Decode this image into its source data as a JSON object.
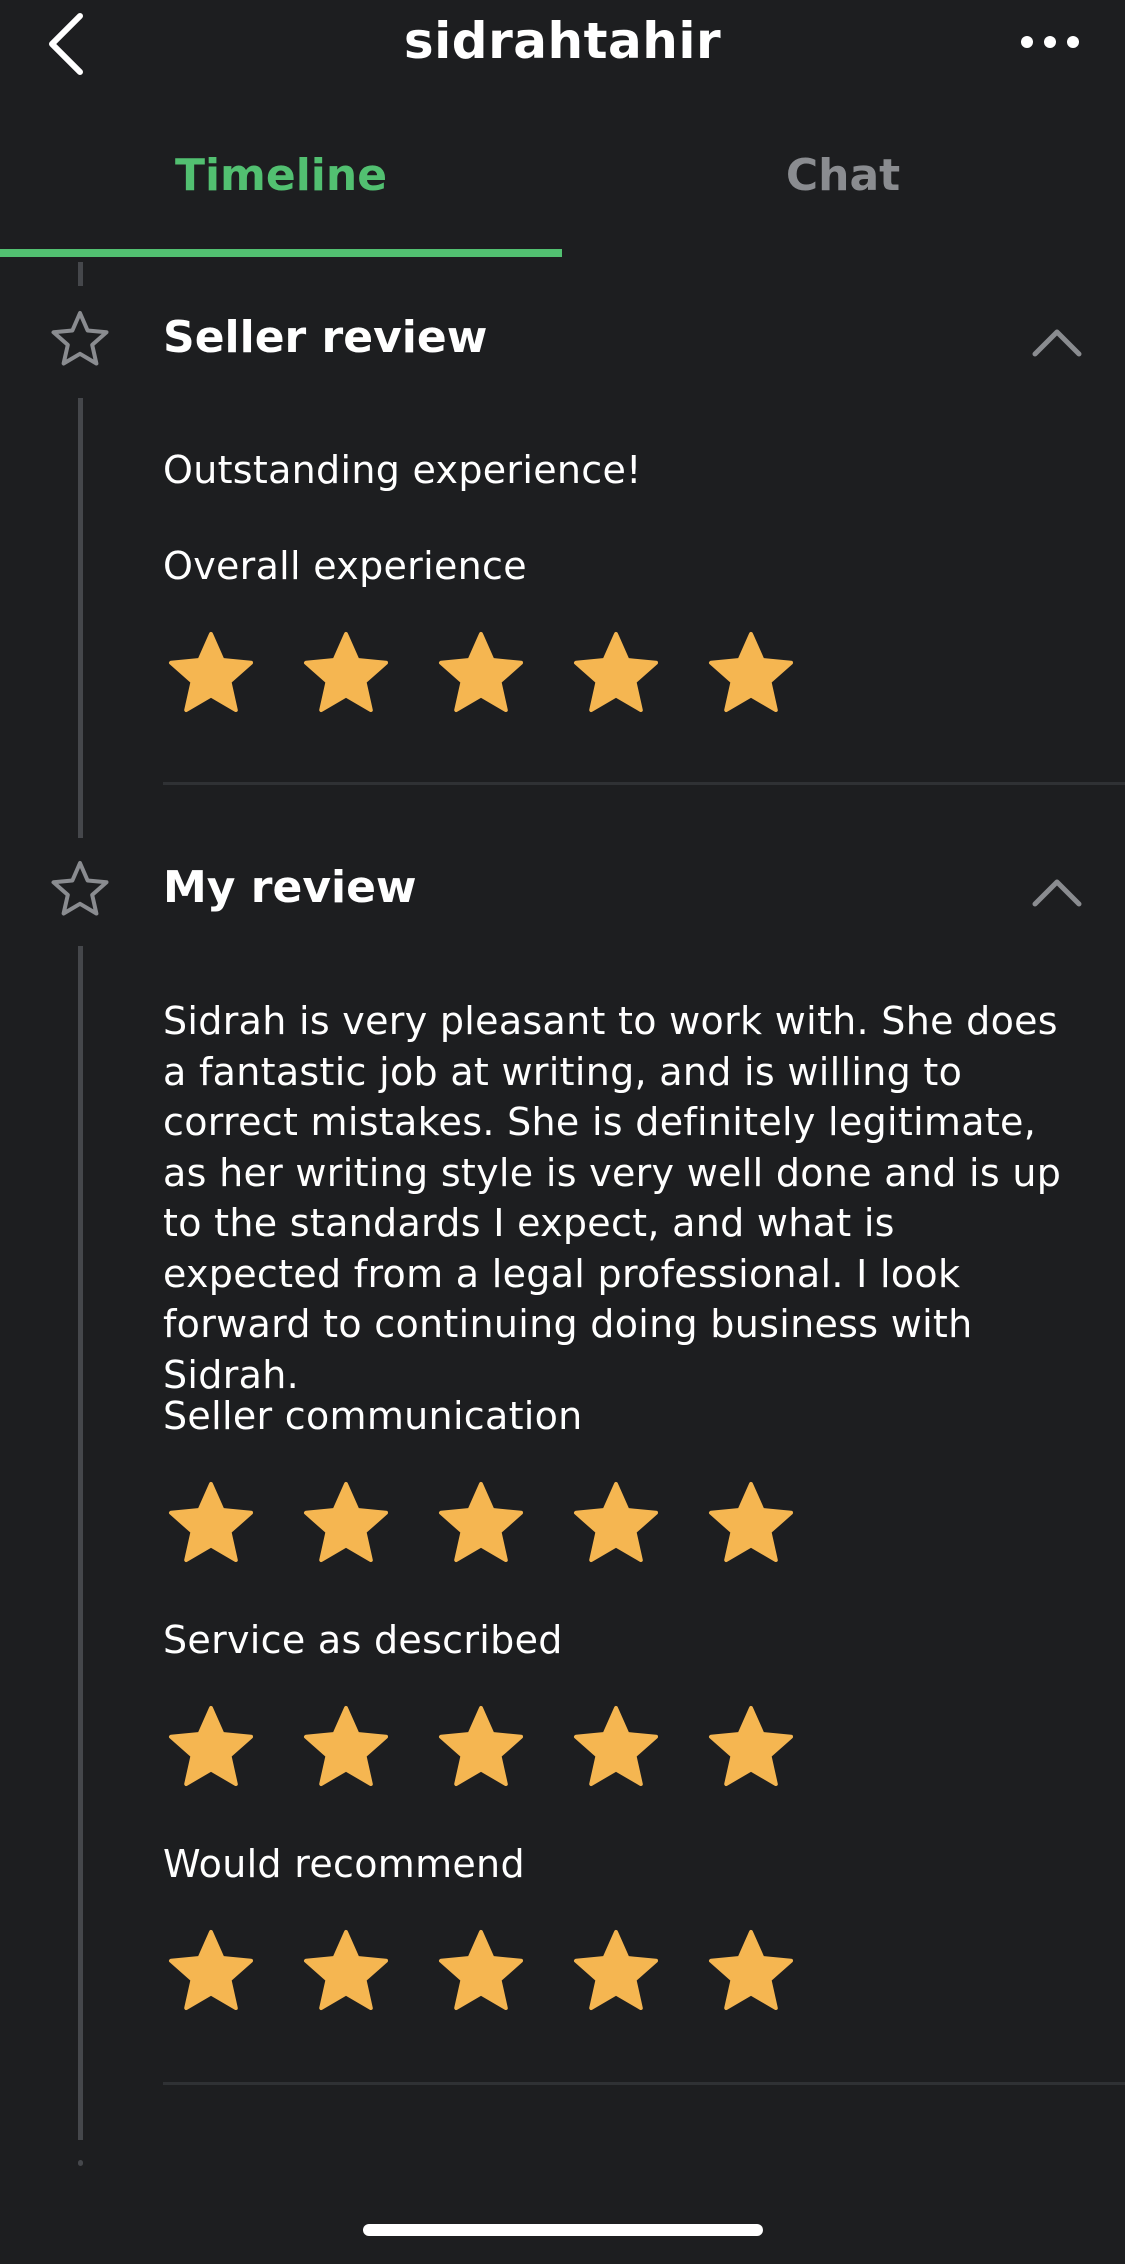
{
  "header": {
    "title": "sidrahtahir"
  },
  "tabs": [
    {
      "label": "Timeline",
      "active": true
    },
    {
      "label": "Chat",
      "active": false
    }
  ],
  "seller_review": {
    "title": "Seller review",
    "summary": "Outstanding experience!",
    "ratings": [
      {
        "label": "Overall experience",
        "stars": 5
      }
    ]
  },
  "my_review": {
    "title": "My review",
    "body": "Sidrah is very pleasant to work with. She does a fantastic job at writing, and is willing to correct mistakes. She is definitely legitimate, as her writing style is very well done and is up to the standards I expect, and what is expected from a legal professional. I look forward to continuing doing business with Sidrah.",
    "ratings": [
      {
        "label": "Seller communication",
        "stars": 5
      },
      {
        "label": "Service as described",
        "stars": 5
      },
      {
        "label": "Would recommend",
        "stars": 5
      }
    ]
  },
  "colors": {
    "accent_green": "#52c071",
    "star_gold": "#f5b651",
    "background": "#1d1e20"
  },
  "icons": [
    "back-chevron-icon",
    "more-dots-icon",
    "star-outline-icon",
    "chevron-up-icon",
    "star-filled-icon"
  ]
}
